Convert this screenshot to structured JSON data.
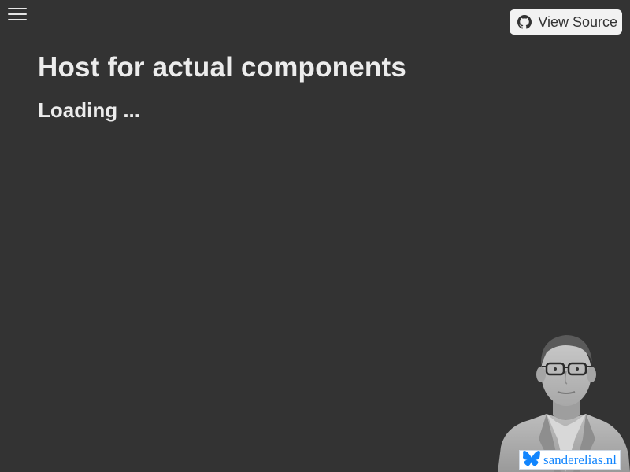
{
  "header": {
    "menu_icon": "hamburger-menu-icon",
    "view_source": {
      "label": "View Source",
      "icon": "github-icon"
    }
  },
  "main": {
    "title": "Host for actual components",
    "status": "Loading ..."
  },
  "author_badge": {
    "photo": "author-portrait",
    "site_label": "sanderelias.nl",
    "site_icon": "butterfly-icon",
    "brand_color": "#1185fe"
  },
  "colors": {
    "background": "#333333",
    "text": "#ececec",
    "button_background": "#f2f2f2"
  }
}
